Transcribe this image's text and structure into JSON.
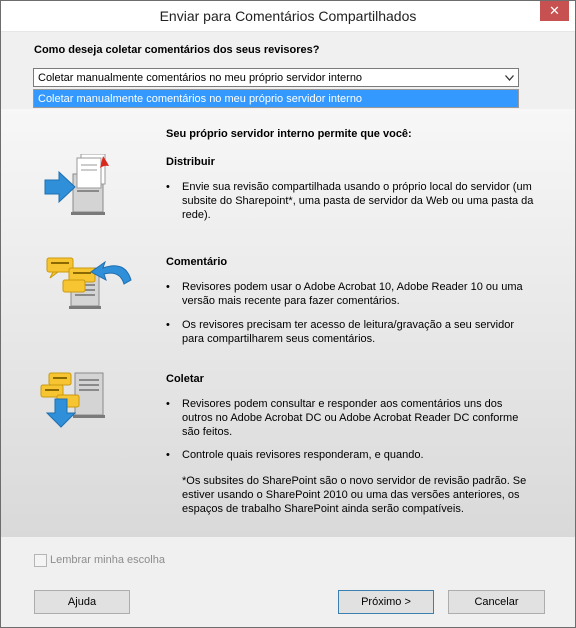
{
  "window": {
    "title": "Enviar para Comentários Compartilhados",
    "close_glyph": "✕"
  },
  "question": "Como deseja coletar comentários dos seus revisores?",
  "method_select": {
    "selected": "Coletar manualmente comentários no meu próprio servidor interno",
    "highlighted_option": "Coletar manualmente comentários no meu próprio servidor interno"
  },
  "intro": "Seu próprio servidor interno permite que você:",
  "sections": {
    "distribute": {
      "title": "Distribuir",
      "bullets": [
        "Envie sua revisão compartilhada usando o próprio local do servidor (um subsite do Sharepoint*, uma pasta de servidor da Web ou uma pasta da rede)."
      ]
    },
    "comment": {
      "title": "Comentário",
      "bullets": [
        "Revisores podem usar o Adobe Acrobat 10, Adobe Reader 10 ou uma versão mais recente para fazer comentários.",
        "Os revisores precisam ter acesso de leitura/gravação a seu servidor para compartilharem seus comentários."
      ]
    },
    "collect": {
      "title": "Coletar",
      "bullets": [
        "Revisores podem consultar e responder aos comentários uns dos outros no Adobe Acrobat DC ou Adobe Acrobat Reader DC conforme são feitos.",
        "Controle quais revisores responderam, e quando."
      ],
      "footnote": "*Os subsites do SharePoint são o novo servidor de revisão padrão. Se estiver usando o SharePoint 2010 ou uma das versões anteriores, os espaços de trabalho SharePoint ainda serão compatíveis."
    }
  },
  "bullet_glyph": "•",
  "remember": "Lembrar minha escolha",
  "buttons": {
    "help": "Ajuda",
    "next": "Próximo >",
    "cancel": "Cancelar"
  },
  "icons": {
    "distribute": "distribute-server-icon",
    "comment": "comment-server-icon",
    "collect": "collect-server-icon"
  },
  "colors": {
    "close": "#c75050",
    "highlight": "#3399ff",
    "arrow": "#2f8fd8",
    "bubble": "#f7c531"
  }
}
